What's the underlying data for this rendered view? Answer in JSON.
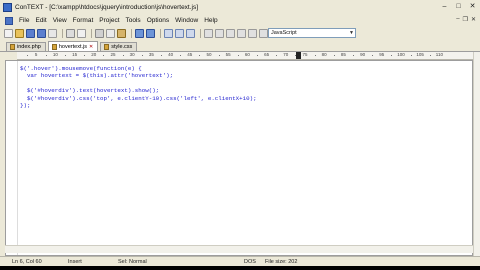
{
  "window": {
    "title": "ConTEXT - [C:\\xampp\\htdocs\\jquery\\introduction\\js\\hovertext.js]"
  },
  "menu": [
    "File",
    "Edit",
    "View",
    "Format",
    "Project",
    "Tools",
    "Options",
    "Window",
    "Help"
  ],
  "toolbar": {
    "language": "JavaScript"
  },
  "tabs": [
    {
      "label": "index.php",
      "active": false
    },
    {
      "label": "hovertext.js",
      "active": true
    },
    {
      "label": "style.css",
      "active": false
    }
  ],
  "ruler": {
    "ticks": [
      "5",
      "10",
      "15",
      "20",
      "25",
      "30",
      "35",
      "40",
      "45",
      "50",
      "55",
      "60",
      "65",
      "70",
      "75",
      "80",
      "85",
      "90",
      "95",
      "100",
      "105",
      "110"
    ]
  },
  "code": [
    "$('.hover').mousemove(function(e) {",
    "  var hovertext = $(this).attr('hovertext');",
    "",
    "  $('#hoverdiv').text(hovertext).show();",
    "  $('#hoverdiv').css('top', e.clientY-10).css('left', e.clientX+10);",
    "});"
  ],
  "status": {
    "position": "Ln 6, Col 60",
    "mode": "Insert",
    "selection": "Sel: Normal",
    "encoding": "DOS",
    "filesize": "File size: 202"
  }
}
